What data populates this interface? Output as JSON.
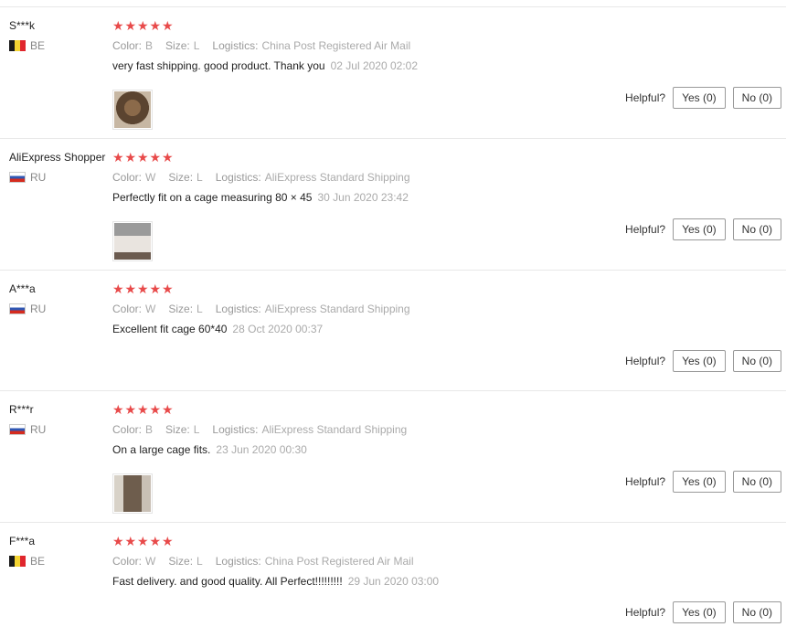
{
  "reviews": [
    {
      "user": "S***k",
      "country_code": "BE",
      "flag": "be",
      "stars": 5,
      "color_label": "Color:",
      "color_value": "B",
      "size_label": "Size:",
      "size_value": "L",
      "logistics_label": "Logistics:",
      "logistics_value": "China Post Registered Air Mail",
      "text": "very fast shipping. good product. Thank you",
      "date": "02 Jul 2020 02:02",
      "has_photo": true,
      "helpful_label": "Helpful?",
      "yes_label": "Yes (0)",
      "no_label": "No (0)"
    },
    {
      "user": "AliExpress Shopper",
      "country_code": "RU",
      "flag": "ru",
      "stars": 5,
      "color_label": "Color:",
      "color_value": "W",
      "size_label": "Size:",
      "size_value": "L",
      "logistics_label": "Logistics:",
      "logistics_value": "AliExpress Standard Shipping",
      "text": "Perfectly fit on a cage measuring 80 × 45",
      "date": "30 Jun 2020 23:42",
      "has_photo": true,
      "helpful_label": "Helpful?",
      "yes_label": "Yes (0)",
      "no_label": "No (0)"
    },
    {
      "user": "A***a",
      "country_code": "RU",
      "flag": "ru",
      "stars": 5,
      "color_label": "Color:",
      "color_value": "W",
      "size_label": "Size:",
      "size_value": "L",
      "logistics_label": "Logistics:",
      "logistics_value": "AliExpress Standard Shipping",
      "text": "Excellent fit cage 60*40",
      "date": "28 Oct 2020 00:37",
      "has_photo": false,
      "helpful_label": "Helpful?",
      "yes_label": "Yes (0)",
      "no_label": "No (0)"
    },
    {
      "user": "R***r",
      "country_code": "RU",
      "flag": "ru",
      "stars": 5,
      "color_label": "Color:",
      "color_value": "B",
      "size_label": "Size:",
      "size_value": "L",
      "logistics_label": "Logistics:",
      "logistics_value": "AliExpress Standard Shipping",
      "text": "On a large cage fits.",
      "date": "23 Jun 2020 00:30",
      "has_photo": true,
      "helpful_label": "Helpful?",
      "yes_label": "Yes (0)",
      "no_label": "No (0)"
    },
    {
      "user": "F***a",
      "country_code": "BE",
      "flag": "be",
      "stars": 5,
      "color_label": "Color:",
      "color_value": "W",
      "size_label": "Size:",
      "size_value": "L",
      "logistics_label": "Logistics:",
      "logistics_value": "China Post Registered Air Mail",
      "text": "Fast delivery. and good quality. All Perfect!!!!!!!!!",
      "date": "29 Jun 2020 03:00",
      "has_photo": false,
      "helpful_label": "Helpful?",
      "yes_label": "Yes (0)",
      "no_label": "No (0)"
    }
  ],
  "colors": {
    "star": "#e84a4a",
    "divider": "#e8e8e8",
    "muted": "#999999"
  },
  "icons": {
    "star": "star-icon",
    "flag_be": "belgium-flag-icon",
    "flag_ru": "russia-flag-icon"
  }
}
